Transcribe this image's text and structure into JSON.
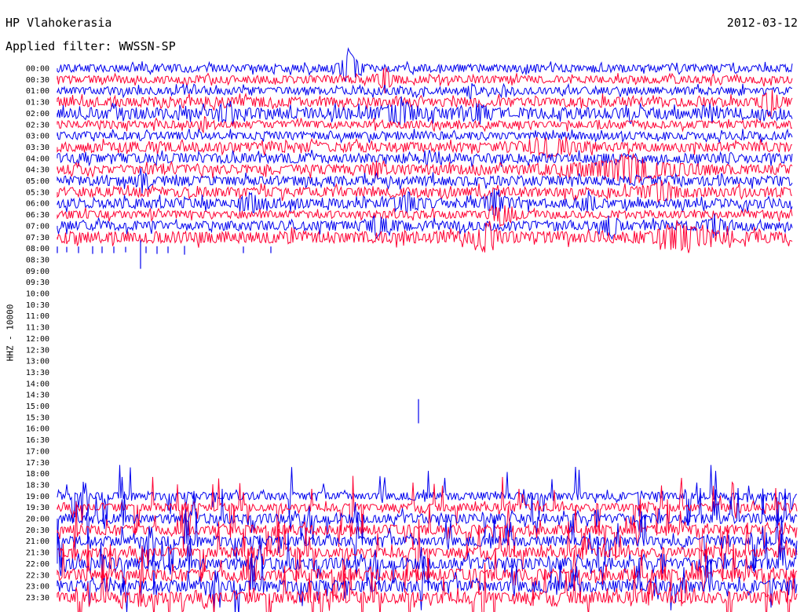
{
  "header": {
    "station": "HP Vlahokerasia",
    "date": "2012-03-12",
    "filter": "Applied filter: WWSSN-SP"
  },
  "chart_data": {
    "type": "line",
    "ylabel": "HHZ - 10000",
    "colors": [
      "#0000ee",
      "#ff0033"
    ],
    "rows": [
      {
        "label": "00:00",
        "amp": 4,
        "events": [
          [
            445,
            20,
            15
          ]
        ],
        "tail": 1010
      },
      {
        "label": "00:30",
        "amp": 4,
        "events": [
          [
            490,
            14,
            10
          ]
        ],
        "tail": 1010
      },
      {
        "label": "01:00",
        "amp": 4,
        "events": [
          [
            600,
            10,
            6
          ]
        ],
        "tail": 1010
      },
      {
        "label": "01:30",
        "amp": 5,
        "events": [
          [
            980,
            14,
            12
          ]
        ],
        "tail": 1010
      },
      {
        "label": "02:00",
        "amp": 6,
        "events": [
          [
            510,
            9,
            30
          ],
          [
            610,
            8,
            15
          ],
          [
            290,
            6,
            10
          ]
        ],
        "tail": 1010
      },
      {
        "label": "02:30",
        "amp": 4,
        "events": [
          [
            260,
            8,
            6
          ]
        ],
        "tail": 1010
      },
      {
        "label": "03:00",
        "amp": 4,
        "events": [],
        "tail": 1010
      },
      {
        "label": "03:30",
        "amp": 5,
        "events": [
          [
            700,
            8,
            40
          ]
        ],
        "tail": 1010
      },
      {
        "label": "04:00",
        "amp": 5,
        "events": [],
        "tail": 1010
      },
      {
        "label": "04:30",
        "amp": 5,
        "events": [
          [
            800,
            12,
            80
          ],
          [
            480,
            8,
            10
          ]
        ],
        "tail": 1010
      },
      {
        "label": "05:00",
        "amp": 5,
        "events": [
          [
            180,
            8,
            10
          ]
        ],
        "tail": 1010
      },
      {
        "label": "05:30",
        "amp": 5,
        "events": [
          [
            840,
            8,
            30
          ]
        ],
        "tail": 1010
      },
      {
        "label": "06:00",
        "amp": 5,
        "events": [
          [
            320,
            10,
            15
          ],
          [
            520,
            10,
            15
          ],
          [
            630,
            14,
            15
          ],
          [
            750,
            9,
            12
          ]
        ],
        "tail": 1010
      },
      {
        "label": "06:30",
        "amp": 4,
        "events": [
          [
            640,
            10,
            20
          ]
        ],
        "tail": 1010
      },
      {
        "label": "07:00",
        "amp": 5,
        "events": [
          [
            480,
            10,
            20
          ],
          [
            780,
            10,
            12
          ],
          [
            910,
            9,
            12
          ]
        ],
        "tail": 1010
      },
      {
        "label": "07:30",
        "amp": 6,
        "events": [
          [
            620,
            12,
            20
          ],
          [
            870,
            12,
            40
          ]
        ],
        "tail": 1010
      },
      {
        "label": "08:00",
        "amp": 0,
        "events": [],
        "tail": 0,
        "spikes": [
          [
            73,
            6
          ],
          [
            85,
            5
          ],
          [
            100,
            6
          ],
          [
            118,
            7
          ],
          [
            130,
            6
          ],
          [
            145,
            6
          ],
          [
            160,
            5
          ],
          [
            179,
            26
          ],
          [
            186,
            6
          ],
          [
            200,
            7
          ],
          [
            214,
            6
          ],
          [
            235,
            8
          ],
          [
            310,
            6
          ],
          [
            345,
            6
          ]
        ]
      },
      {
        "label": "08:30",
        "amp": 0,
        "events": [],
        "tail": 0
      },
      {
        "label": "09:00",
        "amp": 0,
        "events": [],
        "tail": 0
      },
      {
        "label": "09:30",
        "amp": 0,
        "events": [],
        "tail": 0
      },
      {
        "label": "10:00",
        "amp": 0,
        "events": [],
        "tail": 0
      },
      {
        "label": "10:30",
        "amp": 0,
        "events": [],
        "tail": 0
      },
      {
        "label": "11:00",
        "amp": 0,
        "events": [],
        "tail": 0
      },
      {
        "label": "11:30",
        "amp": 0,
        "events": [],
        "tail": 0
      },
      {
        "label": "12:00",
        "amp": 0,
        "events": [],
        "tail": 0
      },
      {
        "label": "12:30",
        "amp": 0,
        "events": [],
        "tail": 0
      },
      {
        "label": "13:00",
        "amp": 0,
        "events": [],
        "tail": 0
      },
      {
        "label": "13:30",
        "amp": 0,
        "events": [],
        "tail": 0
      },
      {
        "label": "14:00",
        "amp": 0,
        "events": [],
        "tail": 0
      },
      {
        "label": "14:30",
        "amp": 0,
        "events": [],
        "tail": 0
      },
      {
        "label": "15:00",
        "amp": 0,
        "events": [],
        "tail": 0,
        "spikes": [
          [
            533,
            22
          ]
        ]
      },
      {
        "label": "15:30",
        "amp": 0,
        "events": [],
        "tail": 0
      },
      {
        "label": "16:00",
        "amp": 0,
        "events": [],
        "tail": 0
      },
      {
        "label": "16:30",
        "amp": 0,
        "events": [],
        "tail": 0
      },
      {
        "label": "17:00",
        "amp": 0,
        "events": [],
        "tail": 0
      },
      {
        "label": "17:30",
        "amp": 0,
        "events": [],
        "tail": 0
      },
      {
        "label": "18:00",
        "amp": 0,
        "events": [],
        "tail": 0
      },
      {
        "label": "18:30",
        "amp": 0,
        "events": [],
        "tail": 0
      },
      {
        "label": "19:00",
        "amp": 4,
        "events": [],
        "tail": 1015,
        "bursty": 1
      },
      {
        "label": "19:30",
        "amp": 4,
        "events": [],
        "tail": 1015,
        "bursty": 1
      },
      {
        "label": "20:00",
        "amp": 5,
        "events": [],
        "tail": 1015,
        "bursty": 1
      },
      {
        "label": "20:30",
        "amp": 5,
        "events": [],
        "tail": 1015,
        "bursty": 1
      },
      {
        "label": "21:00",
        "amp": 5,
        "events": [],
        "tail": 1015,
        "bursty": 1
      },
      {
        "label": "21:30",
        "amp": 5,
        "events": [],
        "tail": 1015,
        "bursty": 1
      },
      {
        "label": "22:00",
        "amp": 6,
        "events": [],
        "tail": 1015,
        "bursty": 1
      },
      {
        "label": "22:30",
        "amp": 6,
        "events": [],
        "tail": 1015,
        "bursty": 1
      },
      {
        "label": "23:00",
        "amp": 6,
        "events": [],
        "tail": 1015,
        "bursty": 1
      },
      {
        "label": "23:30",
        "amp": 6,
        "events": [],
        "tail": 1015,
        "bursty": 1
      }
    ]
  }
}
